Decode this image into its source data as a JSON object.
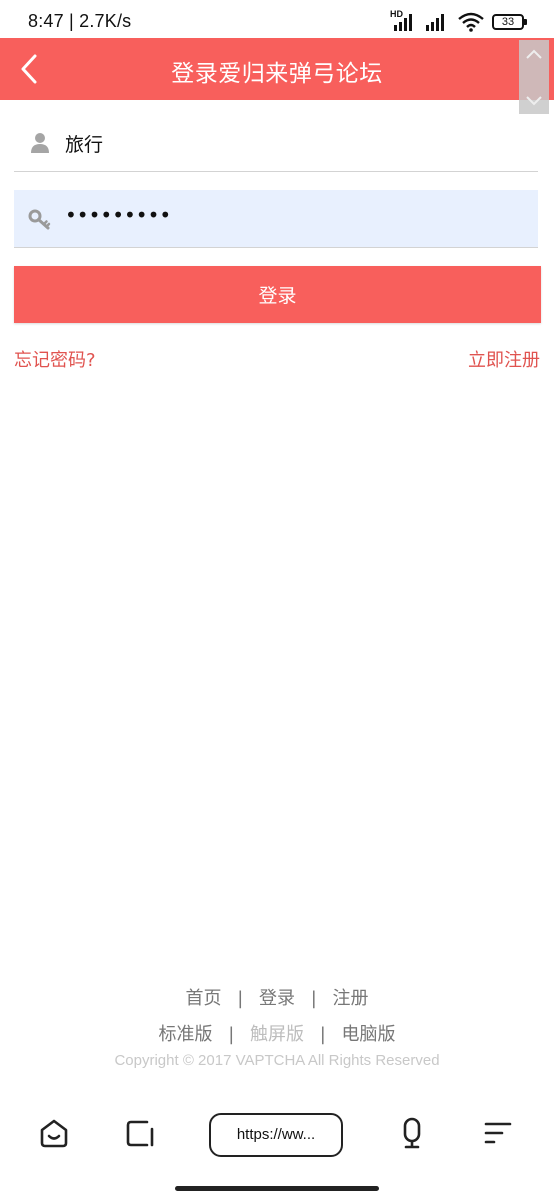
{
  "status_bar": {
    "time_speed": "8:47 | 2.7K/s",
    "hd_label": "HD",
    "battery": "33"
  },
  "header": {
    "title": "登录爱归来弹弓论坛",
    "back_icon": "chevron-left-icon",
    "background": "#f85f5c"
  },
  "form": {
    "username_value": "旅行",
    "username_icon": "user-icon",
    "password_value": "•••••••••",
    "password_icon": "key-icon",
    "login_label": "登录"
  },
  "links": {
    "forgot": "忘记密码?",
    "register": "立即注册"
  },
  "footer": {
    "nav": [
      "首页",
      "登录",
      "注册"
    ],
    "versions": [
      "标准版",
      "触屏版",
      "电脑版"
    ],
    "copyright": "Copyright © 2017 VAPTCHA All Rights Reserved"
  },
  "browser_bar": {
    "url": "https://ww..."
  }
}
